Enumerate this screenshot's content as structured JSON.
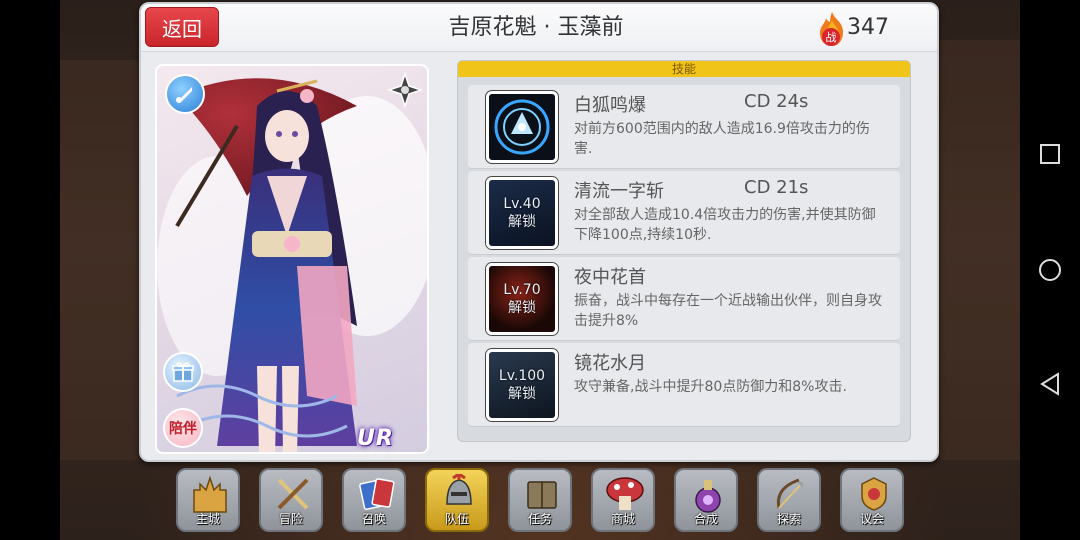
{
  "header": {
    "back_label": "返回",
    "title": "吉原花魁 · 玉藻前",
    "power_icon_label": "战",
    "power_value": "347"
  },
  "card": {
    "companion_label": "陪伴",
    "rarity": "UR"
  },
  "skills": {
    "tab_label": "技能",
    "items": [
      {
        "name": "白狐鸣爆",
        "cd": "CD 24s",
        "desc": "对前方600范围内的敌人造成16.9倍攻击力的伤害.",
        "locked": false,
        "icon": "fox-burst-icon",
        "accent": "#3aa6ff"
      },
      {
        "name": "清流一字斩",
        "cd": "CD 21s",
        "desc": "对全部敌人造成10.4倍攻击力的伤害,并使其防御下降100点,持续10秒.",
        "locked": true,
        "lock_level": "Lv.40",
        "lock_label": "解锁",
        "icon": "water-slash-icon",
        "accent": "#4a6fa8"
      },
      {
        "name": "夜中花首",
        "cd": "",
        "desc": "振奋，战斗中每存在一个近战输出伙伴，则自身攻击提升8%",
        "locked": true,
        "lock_level": "Lv.70",
        "lock_label": "解锁",
        "icon": "night-flower-icon",
        "accent": "#c0392b"
      },
      {
        "name": "镜花水月",
        "cd": "",
        "desc": "攻守兼备,战斗中提升80点防御力和8%攻击.",
        "locked": true,
        "lock_level": "Lv.100",
        "lock_label": "解锁",
        "icon": "mirror-moon-icon",
        "accent": "#7fa6c8"
      }
    ]
  },
  "menu": {
    "items": [
      {
        "label": "主城",
        "icon": "castle-icon",
        "active": false
      },
      {
        "label": "冒险",
        "icon": "crossed-swords-icon",
        "active": false
      },
      {
        "label": "召唤",
        "icon": "summon-cards-icon",
        "active": false
      },
      {
        "label": "队伍",
        "icon": "team-helmet-icon",
        "active": true
      },
      {
        "label": "任务",
        "icon": "quest-book-icon",
        "active": false
      },
      {
        "label": "商城",
        "icon": "shop-mushroom-icon",
        "active": false
      },
      {
        "label": "合成",
        "icon": "potion-icon",
        "active": false
      },
      {
        "label": "探索",
        "icon": "explore-bow-icon",
        "active": false
      },
      {
        "label": "议会",
        "icon": "council-crest-icon",
        "active": false
      }
    ]
  },
  "colors": {
    "back_button": "#d8343a",
    "tab_highlight": "#f0c419",
    "active_menu": "#e0b43a"
  }
}
